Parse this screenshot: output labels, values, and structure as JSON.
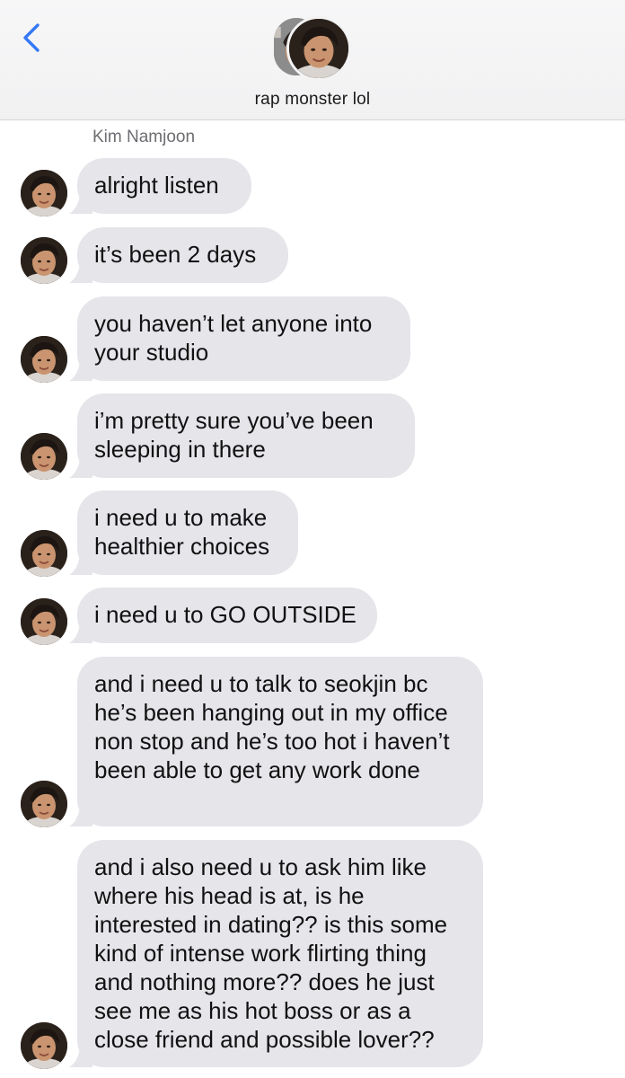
{
  "header": {
    "back_icon": "chevron-left-icon",
    "contact_name": "rap monster lol",
    "accent_color": "#3478f6"
  },
  "conversation": {
    "sender_name": "Kim Namjoon",
    "bubble_color": "#e5e5ea",
    "messages": [
      {
        "text": "alright listen"
      },
      {
        "text": "it’s been 2 days"
      },
      {
        "text": "you haven’t let anyone into your studio"
      },
      {
        "text": "i’m pretty sure you’ve been sleeping in there"
      },
      {
        "text": "i need u to make healthier choices"
      },
      {
        "text": "i need u to GO OUTSIDE"
      },
      {
        "text": "and i need u to talk to seokjin bc he’s been hanging out in my office non stop and he’s too hot i haven’t been able to get any work done"
      },
      {
        "text": "and i also need u to ask him like where his head is at, is he interested in dating?? is this some kind of intense work flirting thing and nothing more?? does he just see me as his hot boss or as a close friend and possible lover??"
      }
    ]
  }
}
